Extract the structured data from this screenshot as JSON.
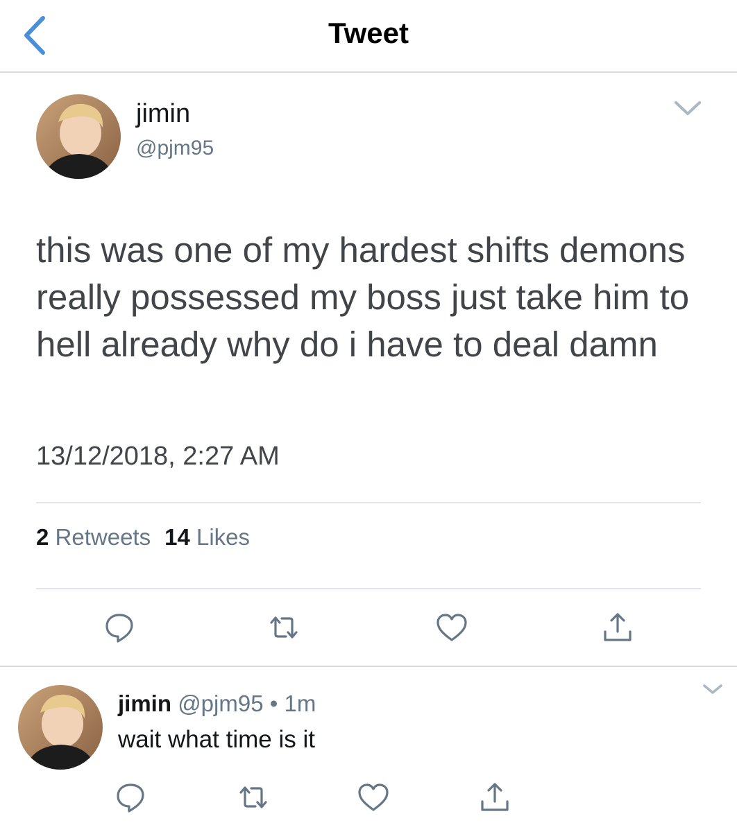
{
  "header": {
    "title": "Tweet",
    "back_icon": "chevron-left-icon"
  },
  "colors": {
    "accent": "#4a90d9",
    "text": "#14171a",
    "secondary": "#657786",
    "body_text": "#414549"
  },
  "tweet": {
    "name": "jimin",
    "handle": "@pjm95",
    "text": "this was one of my hardest shifts demons really possessed my boss just take him to hell already why do i have to deal damn",
    "timestamp": "13/12/2018, 2:27 AM",
    "retweets_count": "2",
    "retweets_label": "Retweets",
    "likes_count": "14",
    "likes_label": "Likes",
    "actions": [
      "reply-icon",
      "retweet-icon",
      "like-icon",
      "share-icon"
    ]
  },
  "reply": {
    "name": "jimin",
    "handle": "@pjm95",
    "separator": "•",
    "time": "1m",
    "text": "wait what time is it",
    "actions": [
      "reply-icon",
      "retweet-icon",
      "like-icon",
      "share-icon"
    ]
  }
}
